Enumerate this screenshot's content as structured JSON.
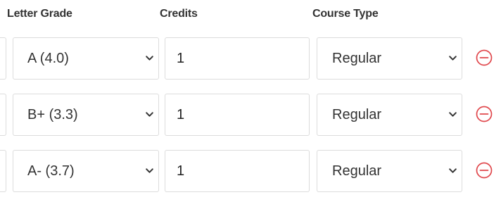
{
  "headers": {
    "letter_grade": "Letter Grade",
    "credits": "Credits",
    "course_type": "Course Type"
  },
  "rows": [
    {
      "grade": "A (4.0)",
      "credits": "1",
      "course_type": "Regular"
    },
    {
      "grade": "B+ (3.3)",
      "credits": "1",
      "course_type": "Regular"
    },
    {
      "grade": "A- (3.7)",
      "credits": "1",
      "course_type": "Regular"
    }
  ],
  "icons": {
    "dropdown": "chevron-down-icon",
    "remove": "minus-circle-icon"
  },
  "colors": {
    "remove_icon": "#e0474c",
    "border": "#dcdcdc",
    "text": "#333333"
  }
}
